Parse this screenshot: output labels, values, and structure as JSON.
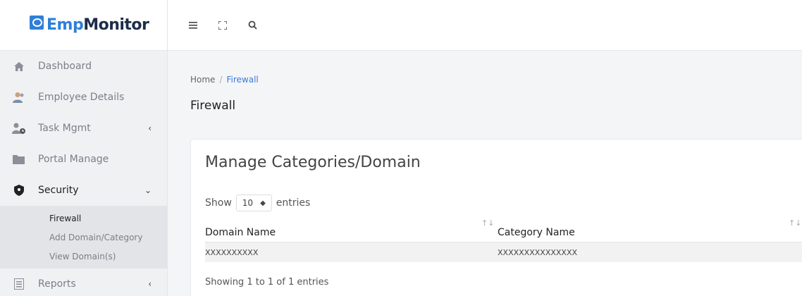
{
  "brand": {
    "name_part1": "Emp",
    "name_part2": "Monitor"
  },
  "sidebar": {
    "items": [
      {
        "label": "Dashboard",
        "icon": "home-icon"
      },
      {
        "label": "Employee Details",
        "icon": "users-icon"
      },
      {
        "label": "Task Mgmt",
        "icon": "user-clock-icon",
        "chevron": "‹"
      },
      {
        "label": "Portal Manage",
        "icon": "folder-icon"
      },
      {
        "label": "Security",
        "icon": "shield-icon",
        "chevron": "⌄"
      },
      {
        "label": "Reports",
        "icon": "report-icon",
        "chevron": "‹"
      }
    ],
    "security_sub": [
      "Firewall",
      "Add Domain/Category",
      "View Domain(s)"
    ]
  },
  "topbar": {
    "icons": [
      "menu-icon",
      "fullscreen-icon",
      "search-icon"
    ]
  },
  "breadcrumb": {
    "home": "Home",
    "separator": "/",
    "current": "Firewall"
  },
  "page_title": "Firewall",
  "card": {
    "title": "Manage Categories/Domain",
    "show_label": "Show",
    "entries_label": "entries",
    "page_size": "10",
    "columns": [
      "Domain Name",
      "Category Name"
    ],
    "rows": [
      [
        "XXXXXXXXXX",
        "XXXXXXXXXXXXXXX"
      ]
    ],
    "info": "Showing 1 to 1 of 1 entries"
  },
  "colors": {
    "accent": "#3a7bd5",
    "brand_blue": "#2f7fd8",
    "brand_dark": "#1c2d4a"
  }
}
